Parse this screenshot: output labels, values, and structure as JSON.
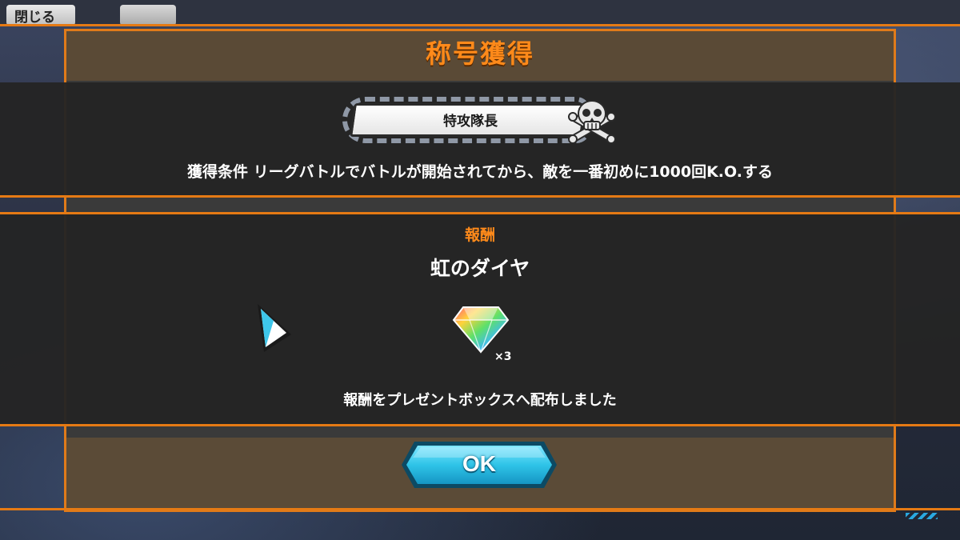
{
  "header": {
    "close_label": "閉じる"
  },
  "dialog": {
    "title": "称号獲得",
    "badge_title": "特攻隊長",
    "condition": "獲得条件 リーグバトルでバトルが開始されてから、敵を一番初めに1000回K.O.する",
    "reward_heading": "報酬",
    "reward_name": "虹のダイヤ",
    "reward_quantity": "×3",
    "delivered_message": "報酬をプレゼントボックスへ配布しました",
    "ok_label": "OK"
  },
  "colors": {
    "accent_orange": "#ff8a1a",
    "band_bg": "#242424",
    "ok_cyan": "#2fc4e8"
  },
  "icons": {
    "skull": "skull-crossbones-icon",
    "gem": "rainbow-diamond-icon",
    "pointer": "triangle-pointer-icon"
  }
}
